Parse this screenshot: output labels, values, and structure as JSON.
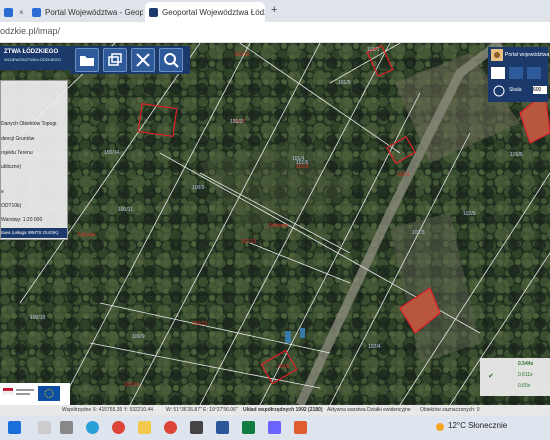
{
  "browser": {
    "tabs": [
      {
        "label": "Portal Województwa - Geoportal",
        "favicon_color": "#2a6bd4"
      },
      {
        "label": "Geoportal Województwa Łódzk",
        "favicon_color": "#1b3a6b",
        "active": true
      }
    ],
    "url": "odzkie.pl/imap/",
    "new_tab_symbol": "+",
    "close_symbol": "×"
  },
  "app": {
    "header_title": "ZTWA ŁÓDZKIEGO",
    "header_subtitle": "WOJEWÓDZTWA ŁÓDZKIEGO",
    "tools": [
      "folder-icon",
      "windows-icon",
      "crossed-tools-icon",
      "search-icon"
    ],
    "layers": [
      {
        "label": "Danych Obiektów Topogr."
      },
      {
        "label": "dencji Gruntów"
      },
      {
        "label": "rojektu Terenu"
      },
      {
        "label": "ubliczne)"
      },
      {
        "label": "e"
      },
      {
        "label": "ODT10k)"
      },
      {
        "label": "Warstwy: 1:20 000"
      }
    ],
    "layers_footer": "tawa (usługa WMTS GUGiK)",
    "right_title": "Portal województwa",
    "scale_label": "Skala",
    "scale_value": "600",
    "scale_options": [
      {
        "value": "0.544x",
        "checked": true
      },
      {
        "value": "0.611x",
        "checked": false
      },
      {
        "value": "0.65x",
        "checked": false
      }
    ]
  },
  "map": {
    "parcel_labels": [
      "100/10",
      "101/1",
      "101/9",
      "101/2",
      "101/4",
      "100/14",
      "101/6",
      "101/3",
      "100/9",
      "101/13",
      "101/6",
      "100/11",
      "100/13",
      "102/5",
      "102/3",
      "102/1",
      "102/4",
      "100/9",
      "102/8",
      "100/10",
      "101/5",
      "100/14"
    ],
    "place_label": "Zofiówka",
    "street_label": "Łąkowa"
  },
  "status": {
    "coords": "Współrzędne X: 415765.35 Y: 532210.44",
    "wgs": "W: 51°36'26.87\" E: 19°27'56.06\"",
    "crs": "Układ współrzędnych 1992 (2180)",
    "active_layer": "Aktywna warstwa Działki ewidencyjne",
    "selected": "Obiektów zaznaczonych: 0"
  },
  "taskbar": {
    "weather": "12°C Słonecznie"
  }
}
